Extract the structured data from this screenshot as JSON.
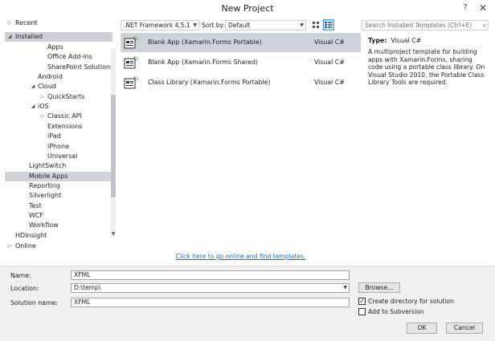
{
  "window": {
    "title": "New Project",
    "help": "?",
    "close": "✕"
  },
  "sidebar": {
    "recent": "Recent",
    "installed": "Installed",
    "online": "Online",
    "items": [
      {
        "label": "Apps",
        "level": 3
      },
      {
        "label": "Office Add-ins",
        "level": 3
      },
      {
        "label": "SharePoint Solutions",
        "level": 3
      },
      {
        "label": "Android",
        "level": 2
      },
      {
        "label": "Cloud",
        "level": 2,
        "expanded": true
      },
      {
        "label": "QuickStarts",
        "level": 3,
        "collapsed": true
      },
      {
        "label": "iOS",
        "level": 2,
        "expanded": true
      },
      {
        "label": "Classic API",
        "level": 3,
        "collapsed": true
      },
      {
        "label": "Extensions",
        "level": 3
      },
      {
        "label": "iPad",
        "level": 3
      },
      {
        "label": "iPhone",
        "level": 3
      },
      {
        "label": "Universal",
        "level": 3
      },
      {
        "label": "LightSwitch",
        "level": 1
      },
      {
        "label": "Mobile Apps",
        "level": 1,
        "selected": true
      },
      {
        "label": "Reporting",
        "level": 1
      },
      {
        "label": "Silverlight",
        "level": 1
      },
      {
        "label": "Test",
        "level": 1
      },
      {
        "label": "WCF",
        "level": 1
      },
      {
        "label": "Workflow",
        "level": 1
      },
      {
        "label": "HDInsight",
        "level": 0
      }
    ]
  },
  "toolbar": {
    "framework": ".NET Framework 4.5.1",
    "sort_label": "Sort by:",
    "sort_value": "Default",
    "search_placeholder": "Search Installed Templates (Ctrl+E)"
  },
  "templates": [
    {
      "name": "Blank App (Xamarin.Forms Portable)",
      "lang": "Visual C#",
      "selected": true
    },
    {
      "name": "Blank App (Xamarin.Forms Shared)",
      "lang": "Visual C#"
    },
    {
      "name": "Class Library (Xamarin.Forms Portable)",
      "lang": "Visual C#"
    }
  ],
  "details": {
    "type_label": "Type:",
    "type_value": "Visual C#",
    "description": "A multiproject template for building apps with Xamarin.Forms, sharing code using a portable class library. On Visual Studio 2010, the Portable Class Library Tools are required."
  },
  "online_link": "Click here to go online and find templates.",
  "form": {
    "name_label": "Name:",
    "name_value": "XFML",
    "location_label": "Location:",
    "location_value": "D:\\temp\\",
    "solution_label": "Solution name:",
    "solution_value": "XFML",
    "browse": "Browse...",
    "create_dir": "Create directory for solution",
    "create_dir_checked": true,
    "add_svn": "Add to Subversion",
    "add_svn_checked": false,
    "ok": "OK",
    "cancel": "Cancel"
  },
  "icons": [
    "help-icon",
    "close-icon",
    "grid-view-icon",
    "list-view-icon",
    "search-icon",
    "csharp-project-icon"
  ]
}
